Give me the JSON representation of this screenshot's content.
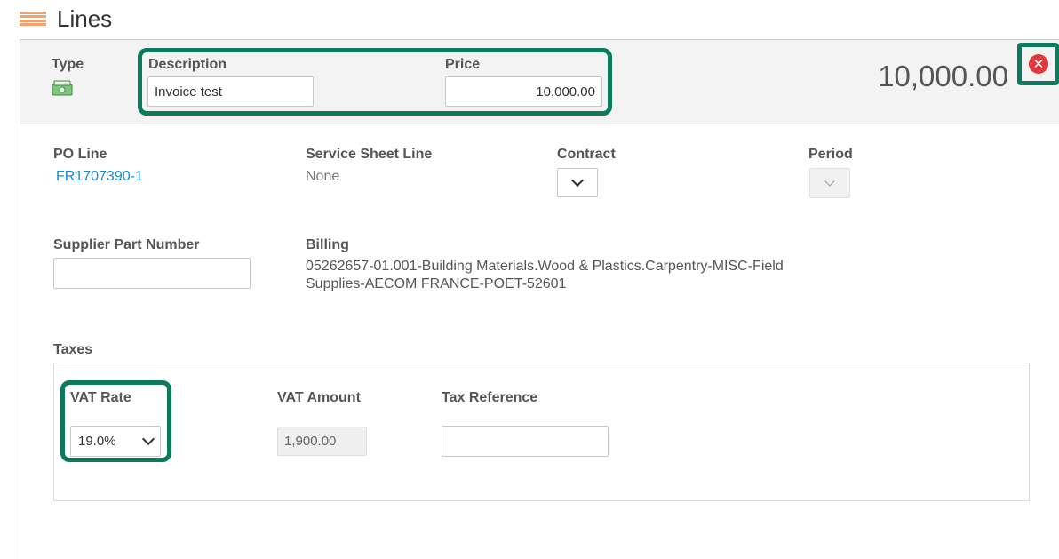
{
  "section": {
    "title": "Lines",
    "icon": "lines-list-icon"
  },
  "line": {
    "type_label": "Type",
    "type_icon": "money-bill-icon",
    "description_label": "Description",
    "description_value": "Invoice test",
    "price_label": "Price",
    "price_value": "10,000.00",
    "total": "10,000.00",
    "remove_icon": "remove-circle-icon"
  },
  "details": {
    "po_line_label": "PO Line",
    "po_line_value": "FR1707390-1",
    "service_sheet_label": "Service Sheet Line",
    "service_sheet_value": "None",
    "contract_label": "Contract",
    "contract_value": "",
    "period_label": "Period",
    "period_value": "",
    "supplier_part_label": "Supplier Part Number",
    "supplier_part_value": "",
    "billing_label": "Billing",
    "billing_line1": "05262657-01.001-Building Materials.Wood & Plastics.Carpentry-MISC-Field",
    "billing_line2": "Supplies-AECOM FRANCE-POET-52601"
  },
  "taxes": {
    "title": "Taxes",
    "vat_rate_label": "VAT Rate",
    "vat_rate_value": "19.0%",
    "vat_amount_label": "VAT Amount",
    "vat_amount_value": "1,900.00",
    "tax_reference_label": "Tax Reference",
    "tax_reference_value": ""
  },
  "colors": {
    "highlight": "#0c7a5c",
    "link": "#1a8ac9",
    "remove": "#e0383e",
    "icon_accent": "#f0a273"
  }
}
